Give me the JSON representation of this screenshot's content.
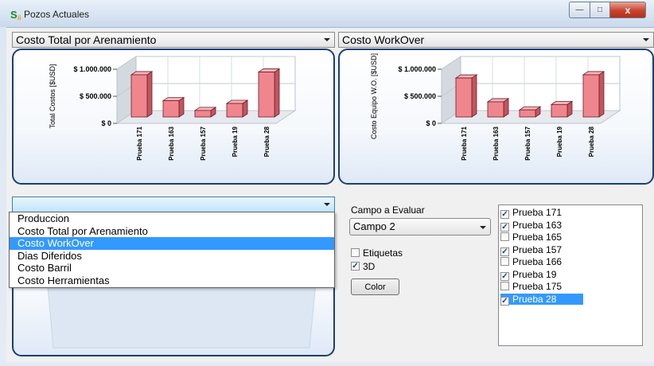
{
  "window": {
    "title": "Pozos Actuales",
    "icon_letter": "S",
    "icon_sub": "ii",
    "min_icon": "minimize-icon",
    "max_icon": "maximize-icon",
    "close_icon": "close-icon",
    "min_glyph": "—",
    "max_glyph": "□",
    "close_glyph": "x"
  },
  "left_top": {
    "selected": "Costo Total por Arenamiento"
  },
  "right_top": {
    "selected": "Costo WorkOver"
  },
  "left_bottom": {
    "selected": ""
  },
  "dropdown_options": [
    "Produccion",
    "Costo Total por Arenamiento",
    "Costo WorkOver",
    "Dias Diferidos",
    "Costo Barril",
    "Costo Herramientas"
  ],
  "dropdown_selected_index": 2,
  "campo_label": "Campo a Evaluar",
  "campo_selected": "Campo 2",
  "etiquetas": {
    "label": "Etiquetas",
    "checked": false
  },
  "view3d": {
    "label": "3D",
    "checked": true
  },
  "color_button": "Color",
  "check_glyph": "✓",
  "list_items": [
    {
      "label": "Prueba 171",
      "checked": true
    },
    {
      "label": "Prueba 163",
      "checked": true
    },
    {
      "label": "Prueba 165",
      "checked": false
    },
    {
      "label": "Prueba 157",
      "checked": true
    },
    {
      "label": "Prueba 166",
      "checked": false
    },
    {
      "label": "Prueba 19",
      "checked": true
    },
    {
      "label": "Prueba 175",
      "checked": false
    },
    {
      "label": "Prueba 28",
      "checked": true,
      "selected": true
    }
  ],
  "colors": {
    "bar_front": "#f0868d",
    "bar_side": "#c25560",
    "bar_top": "#f8b4b8",
    "panel_border": "#1a3f74",
    "selection": "#3399ff"
  },
  "chart_data": [
    {
      "type": "bar",
      "categories": [
        "Prueba 171",
        "Prueba 163",
        "Prueba 157",
        "Prueba 19",
        "Prueba 28"
      ],
      "values": [
        780000,
        300000,
        120000,
        250000,
        830000
      ],
      "ylabel": "Total Costos [$USD]",
      "ylim": [
        0,
        1000000
      ],
      "yticks": [
        "$ 0",
        "$ 500.000",
        "$ 1.000.000"
      ],
      "grid": true,
      "view": "3d"
    },
    {
      "type": "bar",
      "categories": [
        "Prueba 171",
        "Prueba 163",
        "Prueba 157",
        "Prueba 19",
        "Prueba 28"
      ],
      "values": [
        720000,
        280000,
        130000,
        230000,
        780000
      ],
      "ylabel": "Costo Equipo W.O. [$USD]",
      "ylim": [
        0,
        1000000
      ],
      "yticks": [
        "$ 0",
        "$ 500.000",
        "$ 1.000.000"
      ],
      "grid": true,
      "view": "3d"
    }
  ]
}
